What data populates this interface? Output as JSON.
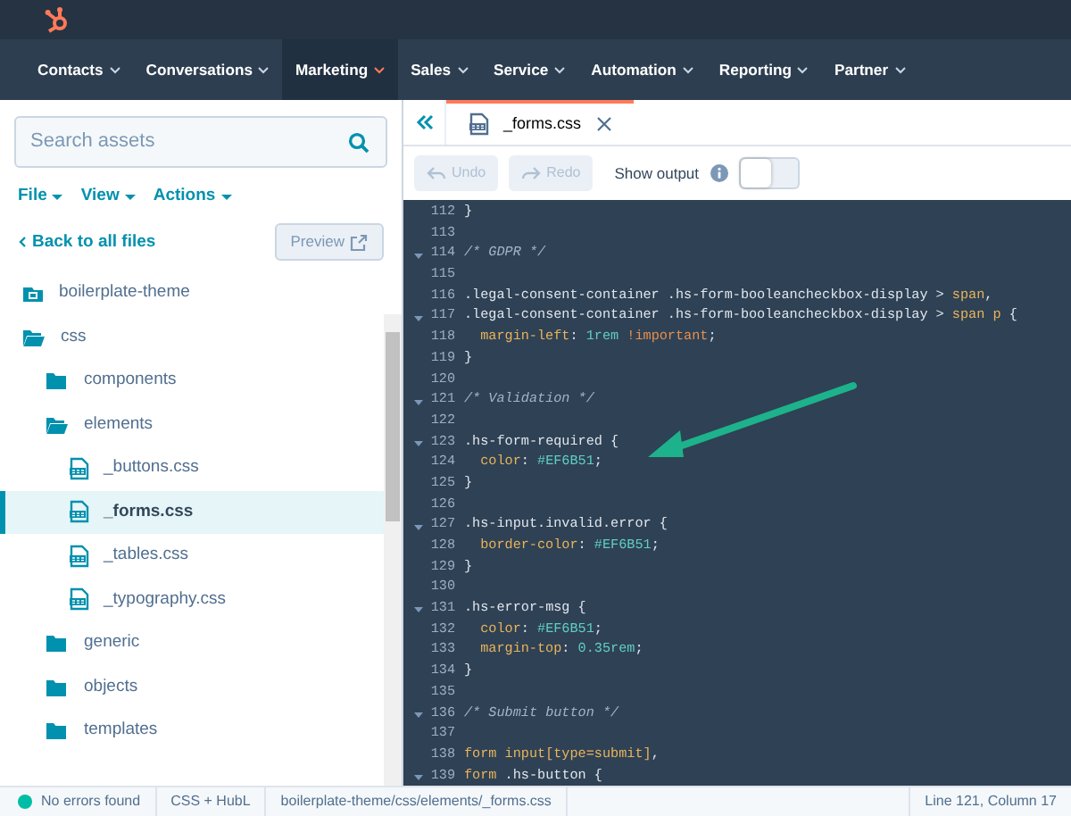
{
  "top_nav": [
    {
      "label": "Contacts",
      "selected": false
    },
    {
      "label": "Conversations",
      "selected": false
    },
    {
      "label": "Marketing",
      "selected": true
    },
    {
      "label": "Sales",
      "selected": false
    },
    {
      "label": "Service",
      "selected": false
    },
    {
      "label": "Automation",
      "selected": false
    },
    {
      "label": "Reporting",
      "selected": false
    },
    {
      "label": "Partner",
      "selected": false
    }
  ],
  "sidebar": {
    "search": {
      "placeholder": "Search assets"
    },
    "menus": [
      "File",
      "View",
      "Actions"
    ],
    "back_link": "Back to all files",
    "preview_button": "Preview",
    "tree": [
      {
        "kind": "theme",
        "label": "boilerplate-theme",
        "selected": false
      },
      {
        "kind": "folder",
        "label": "css",
        "expanded": true,
        "selected": false,
        "children": [
          {
            "kind": "folder",
            "label": "components",
            "expanded": false,
            "selected": false
          },
          {
            "kind": "folder",
            "label": "elements",
            "expanded": true,
            "selected": false,
            "children": [
              {
                "kind": "file",
                "label": "_buttons.css",
                "selected": false
              },
              {
                "kind": "file",
                "label": "_forms.css",
                "selected": true
              },
              {
                "kind": "file",
                "label": "_tables.css",
                "selected": false
              },
              {
                "kind": "file",
                "label": "_typography.css",
                "selected": false
              }
            ]
          },
          {
            "kind": "folder",
            "label": "generic",
            "expanded": false,
            "selected": false
          },
          {
            "kind": "folder",
            "label": "objects",
            "expanded": false,
            "selected": false
          },
          {
            "kind": "folder",
            "label": "templates",
            "expanded": false,
            "selected": false
          }
        ]
      }
    ]
  },
  "editor": {
    "tabs": [
      {
        "label": "_forms.css",
        "selected": true
      }
    ],
    "toolbar": {
      "undo": {
        "label": "Undo",
        "disabled": true
      },
      "redo": {
        "label": "Redo",
        "disabled": true
      },
      "show_output": {
        "label": "Show output",
        "on": false
      }
    },
    "code_lines": [
      {
        "number": "112",
        "foldable": false,
        "tokens": [
          {
            "kind": "punct",
            "text": "}"
          }
        ]
      },
      {
        "number": "113",
        "foldable": false
      },
      {
        "number": "114",
        "foldable": true,
        "tokens": [
          {
            "kind": "comment",
            "text": "/* GDPR */"
          }
        ]
      },
      {
        "number": "115",
        "foldable": false
      },
      {
        "number": "116",
        "foldable": false,
        "tokens": [
          {
            "kind": "selector",
            "text": ".legal-consent-container .hs-form-booleancheckbox-display > "
          },
          {
            "kind": "tag",
            "text": "span"
          },
          {
            "kind": "punct",
            "text": ","
          }
        ]
      },
      {
        "number": "117",
        "foldable": true,
        "tokens": [
          {
            "kind": "selector",
            "text": ".legal-consent-container .hs-form-booleancheckbox-display > "
          },
          {
            "kind": "tag",
            "text": "span p"
          },
          {
            "kind": "punct",
            "text": " {"
          }
        ]
      },
      {
        "number": "118",
        "foldable": false,
        "indent": true,
        "tokens": [
          {
            "kind": "property",
            "text": "margin-left"
          },
          {
            "kind": "punct",
            "text": ": "
          },
          {
            "kind": "value",
            "text": "1rem"
          },
          {
            "kind": "keyword",
            "text": " !important"
          },
          {
            "kind": "punct",
            "text": ";"
          }
        ]
      },
      {
        "number": "119",
        "foldable": false,
        "tokens": [
          {
            "kind": "punct",
            "text": "}"
          }
        ]
      },
      {
        "number": "120",
        "foldable": false
      },
      {
        "number": "121",
        "foldable": true,
        "tokens": [
          {
            "kind": "comment",
            "text": "/* Validation */"
          }
        ]
      },
      {
        "number": "122",
        "foldable": false
      },
      {
        "number": "123",
        "foldable": true,
        "tokens": [
          {
            "kind": "selector",
            "text": ".hs-form-required"
          },
          {
            "kind": "punct",
            "text": " {"
          }
        ]
      },
      {
        "number": "124",
        "foldable": false,
        "indent": true,
        "tokens": [
          {
            "kind": "property",
            "text": "color"
          },
          {
            "kind": "punct",
            "text": ": "
          },
          {
            "kind": "value",
            "text": "#EF6B51"
          },
          {
            "kind": "punct",
            "text": ";"
          }
        ]
      },
      {
        "number": "125",
        "foldable": false,
        "tokens": [
          {
            "kind": "punct",
            "text": "}"
          }
        ]
      },
      {
        "number": "126",
        "foldable": false
      },
      {
        "number": "127",
        "foldable": true,
        "tokens": [
          {
            "kind": "selector",
            "text": ".hs-input.invalid.error"
          },
          {
            "kind": "punct",
            "text": " {"
          }
        ]
      },
      {
        "number": "128",
        "foldable": false,
        "indent": true,
        "tokens": [
          {
            "kind": "property",
            "text": "border-color"
          },
          {
            "kind": "punct",
            "text": ": "
          },
          {
            "kind": "value",
            "text": "#EF6B51"
          },
          {
            "kind": "punct",
            "text": ";"
          }
        ]
      },
      {
        "number": "129",
        "foldable": false,
        "tokens": [
          {
            "kind": "punct",
            "text": "}"
          }
        ]
      },
      {
        "number": "130",
        "foldable": false
      },
      {
        "number": "131",
        "foldable": true,
        "tokens": [
          {
            "kind": "selector",
            "text": ".hs-error-msg"
          },
          {
            "kind": "punct",
            "text": " {"
          }
        ]
      },
      {
        "number": "132",
        "foldable": false,
        "indent": true,
        "tokens": [
          {
            "kind": "property",
            "text": "color"
          },
          {
            "kind": "punct",
            "text": ": "
          },
          {
            "kind": "value",
            "text": "#EF6B51"
          },
          {
            "kind": "punct",
            "text": ";"
          }
        ]
      },
      {
        "number": "133",
        "foldable": false,
        "indent": true,
        "tokens": [
          {
            "kind": "property",
            "text": "margin-top"
          },
          {
            "kind": "punct",
            "text": ": "
          },
          {
            "kind": "value",
            "text": "0.35rem"
          },
          {
            "kind": "punct",
            "text": ";"
          }
        ]
      },
      {
        "number": "134",
        "foldable": false,
        "tokens": [
          {
            "kind": "punct",
            "text": "}"
          }
        ]
      },
      {
        "number": "135",
        "foldable": false
      },
      {
        "number": "136",
        "foldable": true,
        "tokens": [
          {
            "kind": "comment",
            "text": "/* Submit button */"
          }
        ]
      },
      {
        "number": "137",
        "foldable": false
      },
      {
        "number": "138",
        "foldable": false,
        "tokens": [
          {
            "kind": "tag",
            "text": "form input[type=submit]"
          },
          {
            "kind": "punct",
            "text": ","
          }
        ]
      },
      {
        "number": "139",
        "foldable": true,
        "tokens": [
          {
            "kind": "tag",
            "text": "form"
          },
          {
            "kind": "selector",
            "text": " .hs-button"
          },
          {
            "kind": "punct",
            "text": " {"
          }
        ]
      }
    ]
  },
  "status_bar": {
    "errors": {
      "text": "No errors found",
      "color": "#00bda5"
    },
    "language": "CSS + HubL",
    "path": "boilerplate-theme/css/elements/_forms.css",
    "cursor": "Line 121, Column 17"
  }
}
